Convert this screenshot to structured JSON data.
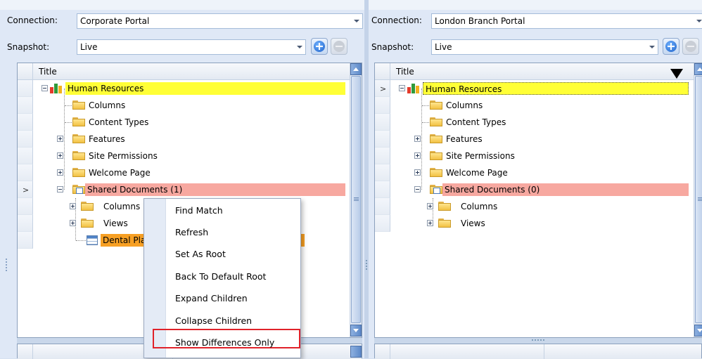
{
  "left": {
    "connection_label": "Connection:",
    "connection_value": "Corporate Portal",
    "snapshot_label": "Snapshot:",
    "snapshot_value": "Live",
    "grid_header": "Title",
    "tree": [
      {
        "label": "Human Resources",
        "highlight": "yellow",
        "icon": "site-icon"
      },
      {
        "label": "Columns",
        "icon": "folder-icon"
      },
      {
        "label": "Content Types",
        "icon": "folder-icon"
      },
      {
        "label": "Features",
        "icon": "folder-icon"
      },
      {
        "label": "Site Permissions",
        "icon": "folder-icon"
      },
      {
        "label": "Welcome Page",
        "icon": "folder-icon"
      },
      {
        "label": "Shared Documents (1)",
        "highlight": "red",
        "icon": "document-library-icon"
      },
      {
        "label": "Columns",
        "icon": "folder-icon"
      },
      {
        "label": "Views",
        "icon": "folder-icon"
      },
      {
        "label": "Dental Plan",
        "highlight": "orange",
        "icon": "list-item-icon"
      }
    ]
  },
  "right": {
    "connection_label": "Connection:",
    "connection_value": "London Branch Portal",
    "snapshot_label": "Snapshot:",
    "snapshot_value": "Live",
    "grid_header": "Title",
    "tree": [
      {
        "label": "Human Resources",
        "highlight": "yellow",
        "icon": "site-icon"
      },
      {
        "label": "Columns",
        "icon": "folder-icon"
      },
      {
        "label": "Content Types",
        "icon": "folder-icon"
      },
      {
        "label": "Features",
        "icon": "folder-icon"
      },
      {
        "label": "Site Permissions",
        "icon": "folder-icon"
      },
      {
        "label": "Welcome Page",
        "icon": "folder-icon"
      },
      {
        "label": "Shared Documents (0)",
        "highlight": "red",
        "icon": "document-library-icon"
      },
      {
        "label": "Columns",
        "icon": "folder-icon"
      },
      {
        "label": "Views",
        "icon": "folder-icon"
      }
    ]
  },
  "context_menu": {
    "items": [
      "Find Match",
      "Refresh",
      "Set As Root",
      "Back To Default Root",
      "Expand Children",
      "Collapse Children",
      "Show Differences Only"
    ],
    "highlighted_item": "Show Differences Only"
  },
  "colors": {
    "highlight_yellow": "#ffff36",
    "highlight_red": "#f7a8a0",
    "highlight_orange": "#f7a024",
    "annotation_box": "#e0222a"
  }
}
